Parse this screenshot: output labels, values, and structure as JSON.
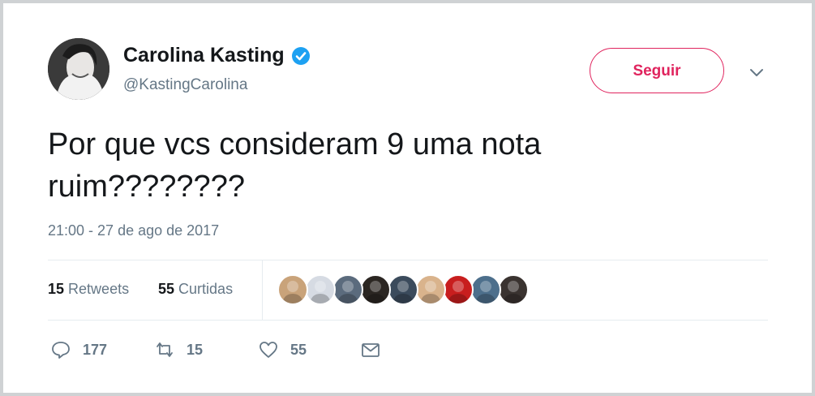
{
  "tweet": {
    "author": {
      "display_name": "Carolina Kasting",
      "handle": "@KastingCarolina",
      "verified": true
    },
    "follow_button_label": "Seguir",
    "text": "Por que vcs consideram 9 uma nota\nruim????????",
    "timestamp": "21:00 - 27 de ago de 2017",
    "stats": {
      "retweets_count": "15",
      "retweets_label": "Retweets",
      "likes_count": "55",
      "likes_label": "Curtidas"
    },
    "liker_avatars": [
      {
        "color": "#c9a37a"
      },
      {
        "color": "#d6dbe3"
      },
      {
        "color": "#5b6b7d"
      },
      {
        "color": "#2b2622"
      },
      {
        "color": "#3b4b5c"
      },
      {
        "color": "#d9b38c"
      },
      {
        "color": "#c81e1e"
      },
      {
        "color": "#4d6f8c"
      },
      {
        "color": "#3a3330"
      }
    ],
    "actions": {
      "reply_count": "177",
      "retweet_count": "15",
      "like_count": "55"
    }
  },
  "colors": {
    "accent_red": "#e0245e",
    "verified_blue": "#1da1f2",
    "secondary_text": "#657786",
    "divider": "#e6ecf0"
  }
}
